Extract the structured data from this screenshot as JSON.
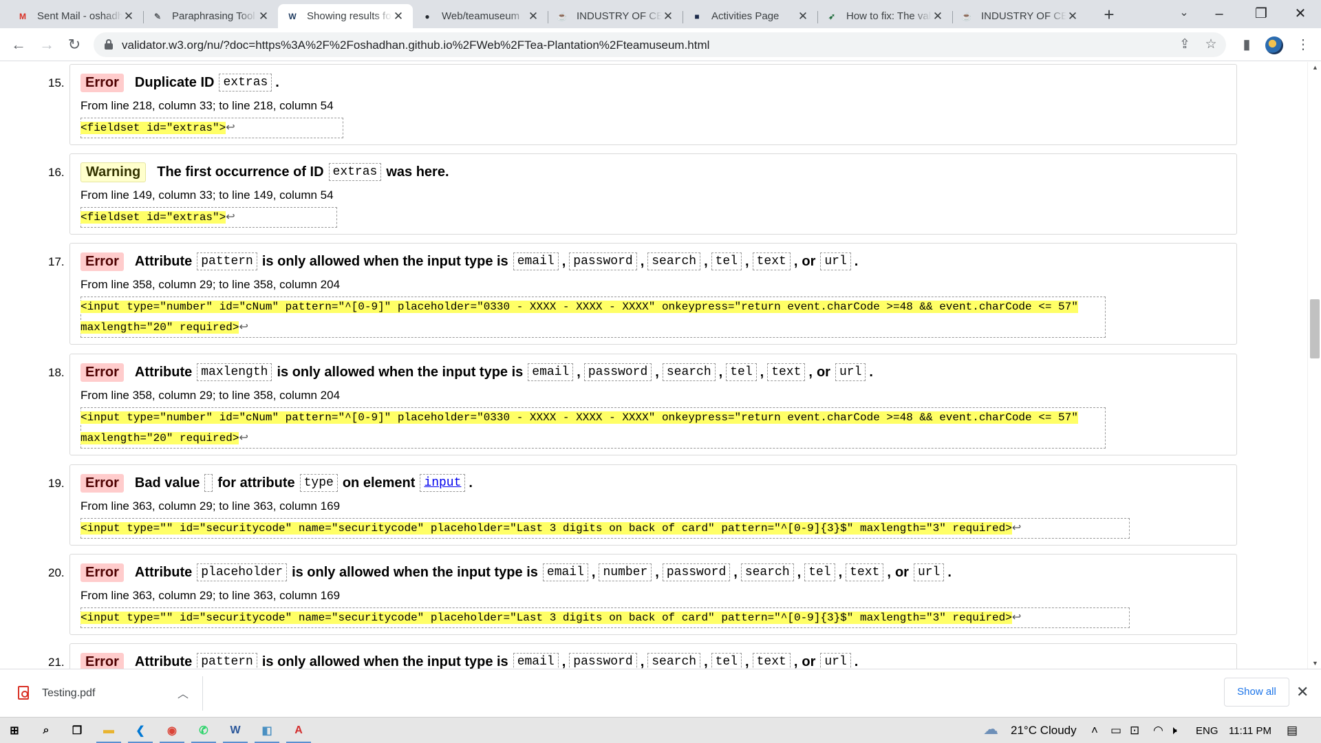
{
  "tabs": [
    {
      "title": "Sent Mail - oshadhan",
      "icon": "gmail-icon",
      "glyph": "M",
      "color": "#d93025",
      "active": false
    },
    {
      "title": "Paraphrasing Tool",
      "icon": "quill-icon",
      "glyph": "✎",
      "color": "#5f6368",
      "active": false
    },
    {
      "title": "Showing results for",
      "icon": "w3c-validator-icon",
      "glyph": "W",
      "color": "#1e3a5f",
      "active": true
    },
    {
      "title": "Web/teamuseum",
      "icon": "github-icon",
      "glyph": "●",
      "color": "#24292f",
      "active": false
    },
    {
      "title": "INDUSTRY OF CEYLON",
      "icon": "tea-site-icon",
      "glyph": "☕",
      "color": "#c79a2b",
      "active": false
    },
    {
      "title": "Activities Page",
      "icon": "activities-icon",
      "glyph": "■",
      "color": "#1b2a4a",
      "active": false
    },
    {
      "title": "How to fix: The value",
      "icon": "rocket-icon",
      "glyph": "➶",
      "color": "#1e6b3a",
      "active": false
    },
    {
      "title": "INDUSTRY OF CEYLON",
      "icon": "tea-site-icon",
      "glyph": "☕",
      "color": "#c79a2b",
      "active": false
    }
  ],
  "address": {
    "url": "validator.w3.org/nu/?doc=https%3A%2F%2Foshadhan.github.io%2FWeb%2FTea-Plantation%2Fteamuseum.html"
  },
  "messages": [
    {
      "number": "15.",
      "type": "Error",
      "parts": [
        {
          "t": "text",
          "v": "Duplicate ID"
        },
        {
          "t": "code",
          "v": "extras"
        },
        {
          "t": "sep",
          "v": "."
        }
      ],
      "location": "From line 218, column 33; to line 218, column 54",
      "extract": [
        "            <fieldset id=\"extras\">"
      ]
    },
    {
      "number": "16.",
      "type": "Warning",
      "parts": [
        {
          "t": "text",
          "v": "The first occurrence of ID"
        },
        {
          "t": "code",
          "v": "extras"
        },
        {
          "t": "text",
          "v": "was here."
        }
      ],
      "location": "From line 149, column 33; to line 149, column 54",
      "extract": [
        "           <fieldset id=\"extras\">"
      ]
    },
    {
      "number": "17.",
      "type": "Error",
      "parts": [
        {
          "t": "text",
          "v": "Attribute"
        },
        {
          "t": "code",
          "v": "pattern"
        },
        {
          "t": "text",
          "v": "is only allowed when the input type is"
        },
        {
          "t": "code",
          "v": "email"
        },
        {
          "t": "sep",
          "v": ","
        },
        {
          "t": "code",
          "v": "password"
        },
        {
          "t": "sep",
          "v": ","
        },
        {
          "t": "code",
          "v": "search"
        },
        {
          "t": "sep",
          "v": ","
        },
        {
          "t": "code",
          "v": "tel"
        },
        {
          "t": "sep",
          "v": ","
        },
        {
          "t": "code",
          "v": "text"
        },
        {
          "t": "sep",
          "v": ","
        },
        {
          "t": "text",
          "v": "or"
        },
        {
          "t": "code",
          "v": "url"
        },
        {
          "t": "sep",
          "v": "."
        }
      ],
      "location": "From line 358, column 29; to line 358, column 204",
      "extract": [
        "            <input type=\"number\" id=\"cNum\" pattern=\"^[0-9]\" placeholder=\"0330 - XXXX - XXXX - XXXX\" onkeypress=\"return event.charCode >=48 && event.charCode <= 57\"",
        "maxlength=\"20\" required>"
      ]
    },
    {
      "number": "18.",
      "type": "Error",
      "parts": [
        {
          "t": "text",
          "v": "Attribute"
        },
        {
          "t": "code",
          "v": "maxlength"
        },
        {
          "t": "text",
          "v": "is only allowed when the input type is"
        },
        {
          "t": "code",
          "v": "email"
        },
        {
          "t": "sep",
          "v": ","
        },
        {
          "t": "code",
          "v": "password"
        },
        {
          "t": "sep",
          "v": ","
        },
        {
          "t": "code",
          "v": "search"
        },
        {
          "t": "sep",
          "v": ","
        },
        {
          "t": "code",
          "v": "tel"
        },
        {
          "t": "sep",
          "v": ","
        },
        {
          "t": "code",
          "v": "text"
        },
        {
          "t": "sep",
          "v": ","
        },
        {
          "t": "text",
          "v": "or"
        },
        {
          "t": "code",
          "v": "url"
        },
        {
          "t": "sep",
          "v": "."
        }
      ],
      "location": "From line 358, column 29; to line 358, column 204",
      "extract": [
        "            <input type=\"number\" id=\"cNum\" pattern=\"^[0-9]\" placeholder=\"0330 - XXXX - XXXX - XXXX\" onkeypress=\"return event.charCode >=48 && event.charCode <= 57\"",
        "maxlength=\"20\" required>"
      ]
    },
    {
      "number": "19.",
      "type": "Error",
      "parts": [
        {
          "t": "text",
          "v": "Bad value"
        },
        {
          "t": "code",
          "v": ""
        },
        {
          "t": "text",
          "v": "for attribute"
        },
        {
          "t": "code",
          "v": "type"
        },
        {
          "t": "text",
          "v": "on element"
        },
        {
          "t": "link",
          "v": "input"
        },
        {
          "t": "sep",
          "v": "."
        }
      ],
      "location": "From line 363, column 29; to line 363, column 169",
      "extract": [
        "            <input type=\"\" id=\"securitycode\" name=\"securitycode\" placeholder=\"Last 3 digits on back of card\" pattern=\"^[0-9]{3}$\" maxlength=\"3\" required>"
      ]
    },
    {
      "number": "20.",
      "type": "Error",
      "parts": [
        {
          "t": "text",
          "v": "Attribute"
        },
        {
          "t": "code",
          "v": "placeholder"
        },
        {
          "t": "text",
          "v": "is only allowed when the input type is"
        },
        {
          "t": "code",
          "v": "email"
        },
        {
          "t": "sep",
          "v": ","
        },
        {
          "t": "code",
          "v": "number"
        },
        {
          "t": "sep",
          "v": ","
        },
        {
          "t": "code",
          "v": "password"
        },
        {
          "t": "sep",
          "v": ","
        },
        {
          "t": "code",
          "v": "search"
        },
        {
          "t": "sep",
          "v": ","
        },
        {
          "t": "code",
          "v": "tel"
        },
        {
          "t": "sep",
          "v": ","
        },
        {
          "t": "code",
          "v": "text"
        },
        {
          "t": "sep",
          "v": ","
        },
        {
          "t": "text",
          "v": "or"
        },
        {
          "t": "code",
          "v": "url"
        },
        {
          "t": "sep",
          "v": "."
        }
      ],
      "location": "From line 363, column 29; to line 363, column 169",
      "extract": [
        "            <input type=\"\" id=\"securitycode\" name=\"securitycode\" placeholder=\"Last 3 digits on back of card\" pattern=\"^[0-9]{3}$\" maxlength=\"3\" required>"
      ]
    },
    {
      "number": "21.",
      "type": "Error",
      "parts": [
        {
          "t": "text",
          "v": "Attribute"
        },
        {
          "t": "code",
          "v": "pattern"
        },
        {
          "t": "text",
          "v": "is only allowed when the input type is"
        },
        {
          "t": "code",
          "v": "email"
        },
        {
          "t": "sep",
          "v": ","
        },
        {
          "t": "code",
          "v": "password"
        },
        {
          "t": "sep",
          "v": ","
        },
        {
          "t": "code",
          "v": "search"
        },
        {
          "t": "sep",
          "v": ","
        },
        {
          "t": "code",
          "v": "tel"
        },
        {
          "t": "sep",
          "v": ","
        },
        {
          "t": "code",
          "v": "text"
        },
        {
          "t": "sep",
          "v": ","
        },
        {
          "t": "text",
          "v": "or"
        },
        {
          "t": "code",
          "v": "url"
        },
        {
          "t": "sep",
          "v": "."
        }
      ],
      "location": "",
      "extract": []
    }
  ],
  "line_end_glyph": "↩",
  "downloads": {
    "file_name": "Testing.pdf",
    "show_all": "Show all"
  },
  "taskbar": {
    "apps": [
      {
        "icon": "windows-start-icon",
        "glyph": "⊞",
        "color": "#000000"
      },
      {
        "icon": "search-icon",
        "glyph": "⌕",
        "color": "#000000"
      },
      {
        "icon": "task-view-icon",
        "glyph": "❐",
        "color": "#000000"
      },
      {
        "icon": "file-explorer-icon",
        "glyph": "▬",
        "color": "#e8b431"
      },
      {
        "icon": "vscode-icon",
        "glyph": "❮",
        "color": "#0078d4"
      },
      {
        "icon": "chrome-icon",
        "glyph": "◉",
        "color": "#db4437"
      },
      {
        "icon": "whatsapp-icon",
        "glyph": "✆",
        "color": "#25d366"
      },
      {
        "icon": "word-icon",
        "glyph": "W",
        "color": "#2b579a"
      },
      {
        "icon": "app-icon",
        "glyph": "◧",
        "color": "#4a90c2"
      },
      {
        "icon": "acrobat-icon",
        "glyph": "A",
        "color": "#d32f2f"
      }
    ],
    "weather": "21°C  Cloudy",
    "language": "ENG",
    "time": "11:11 PM"
  }
}
